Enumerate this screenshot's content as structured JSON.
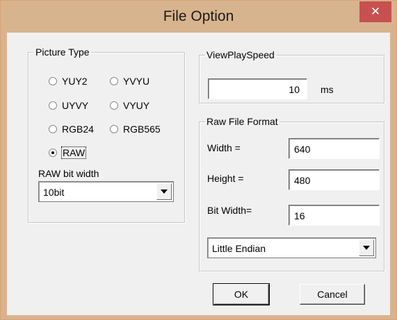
{
  "window": {
    "title": "File Option",
    "close_glyph": "✕"
  },
  "picture_type": {
    "legend": "Picture Type",
    "options": [
      "YUY2",
      "YVYU",
      "UYVY",
      "VYUY",
      "RGB24",
      "RGB565",
      "RAW"
    ],
    "selected": "RAW",
    "raw_bit_width_label": "RAW bit width",
    "raw_bit_width_value": "10bit"
  },
  "view_play_speed": {
    "legend": "ViewPlaySpeed",
    "value": "10",
    "unit": "ms"
  },
  "raw_file_format": {
    "legend": "Raw File Format",
    "width_label": "Width =",
    "width_value": "640",
    "height_label": "Height =",
    "height_value": "480",
    "bitwidth_label": "Bit Width=",
    "bitwidth_value": "16",
    "endian_value": "Little Endian"
  },
  "buttons": {
    "ok": "OK",
    "cancel": "Cancel"
  },
  "icons": {
    "close": "close-icon",
    "dropdown": "chevron-down-icon",
    "radio": "radio-icon"
  }
}
